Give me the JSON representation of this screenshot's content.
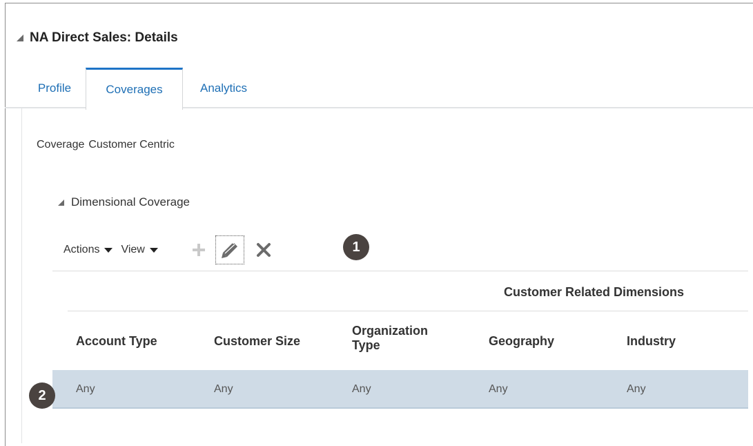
{
  "section": {
    "title": "NA Direct Sales: Details"
  },
  "tabs": [
    {
      "label": "Profile"
    },
    {
      "label": "Coverages"
    },
    {
      "label": "Analytics"
    }
  ],
  "active_tab": "Coverages",
  "coverage": {
    "label": "Coverage",
    "value": "Customer Centric"
  },
  "dimensional": {
    "title": "Dimensional Coverage",
    "toolbar": {
      "actions_label": "Actions",
      "view_label": "View",
      "icons": [
        "plus-icon",
        "edit-icon",
        "delete-icon"
      ]
    },
    "group_header": "Customer Related Dimensions",
    "columns": [
      "Account Type",
      "Customer Size",
      "Organization Type",
      "Geography",
      "Industry"
    ],
    "rows": [
      [
        "Any",
        "Any",
        "Any",
        "Any",
        "Any"
      ]
    ]
  },
  "callouts": [
    "1",
    "2"
  ],
  "colors": {
    "accent": "#1e74c7",
    "selected_row": "#cfdbe6",
    "callout": "#4a4340"
  }
}
